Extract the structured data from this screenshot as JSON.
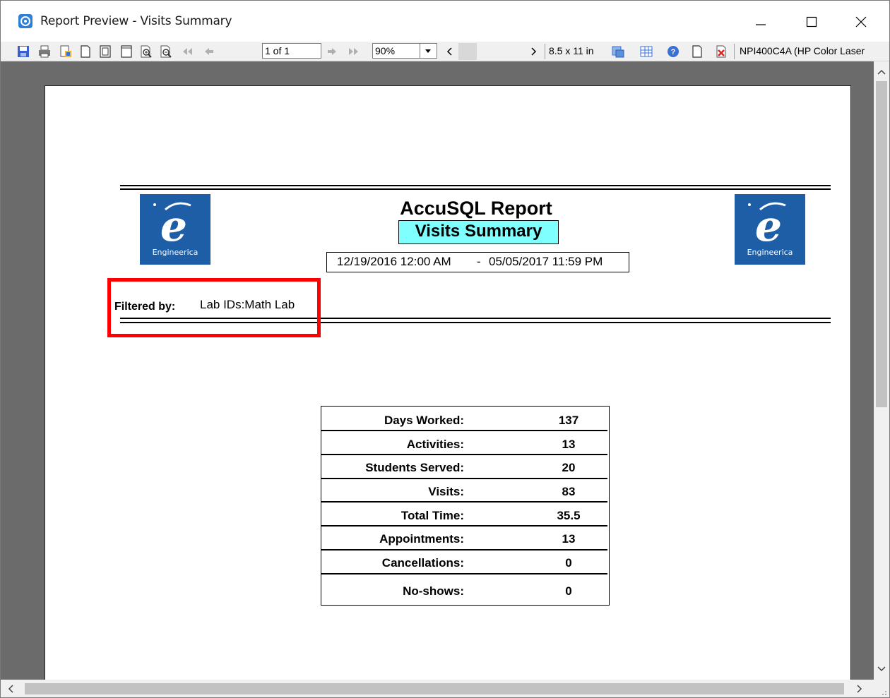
{
  "window": {
    "title": "Report Preview - Visits Summary"
  },
  "toolbar": {
    "page_field": "1 of 1",
    "zoom_field": "90%",
    "page_size": "8.5 x 11 in",
    "printer": "NPI400C4A (HP Color Laser"
  },
  "report": {
    "title": "AccuSQL Report",
    "subtitle": "Visits Summary",
    "date_start": "12/19/2016 12:00 AM",
    "date_sep": "-",
    "date_end": "05/05/2017 11:59 PM",
    "logo_text": "Engineerica",
    "filter_label": "Filtered by:",
    "filter_value": "Lab IDs:Math Lab",
    "highlight_color": "#ff0000",
    "subtitle_bg": "#80ffff",
    "logo_color": "#1d5ea6"
  },
  "summary": [
    {
      "label": "Days Worked:",
      "value": "137"
    },
    {
      "label": "Activities:",
      "value": "13"
    },
    {
      "label": "Students Served:",
      "value": "20"
    },
    {
      "label": "Visits:",
      "value": "83"
    },
    {
      "label": "Total Time:",
      "value": "35.5"
    },
    {
      "label": "Appointments:",
      "value": "13"
    },
    {
      "label": "Cancellations:",
      "value": "0"
    },
    {
      "label": "No-shows:",
      "value": "0"
    }
  ]
}
